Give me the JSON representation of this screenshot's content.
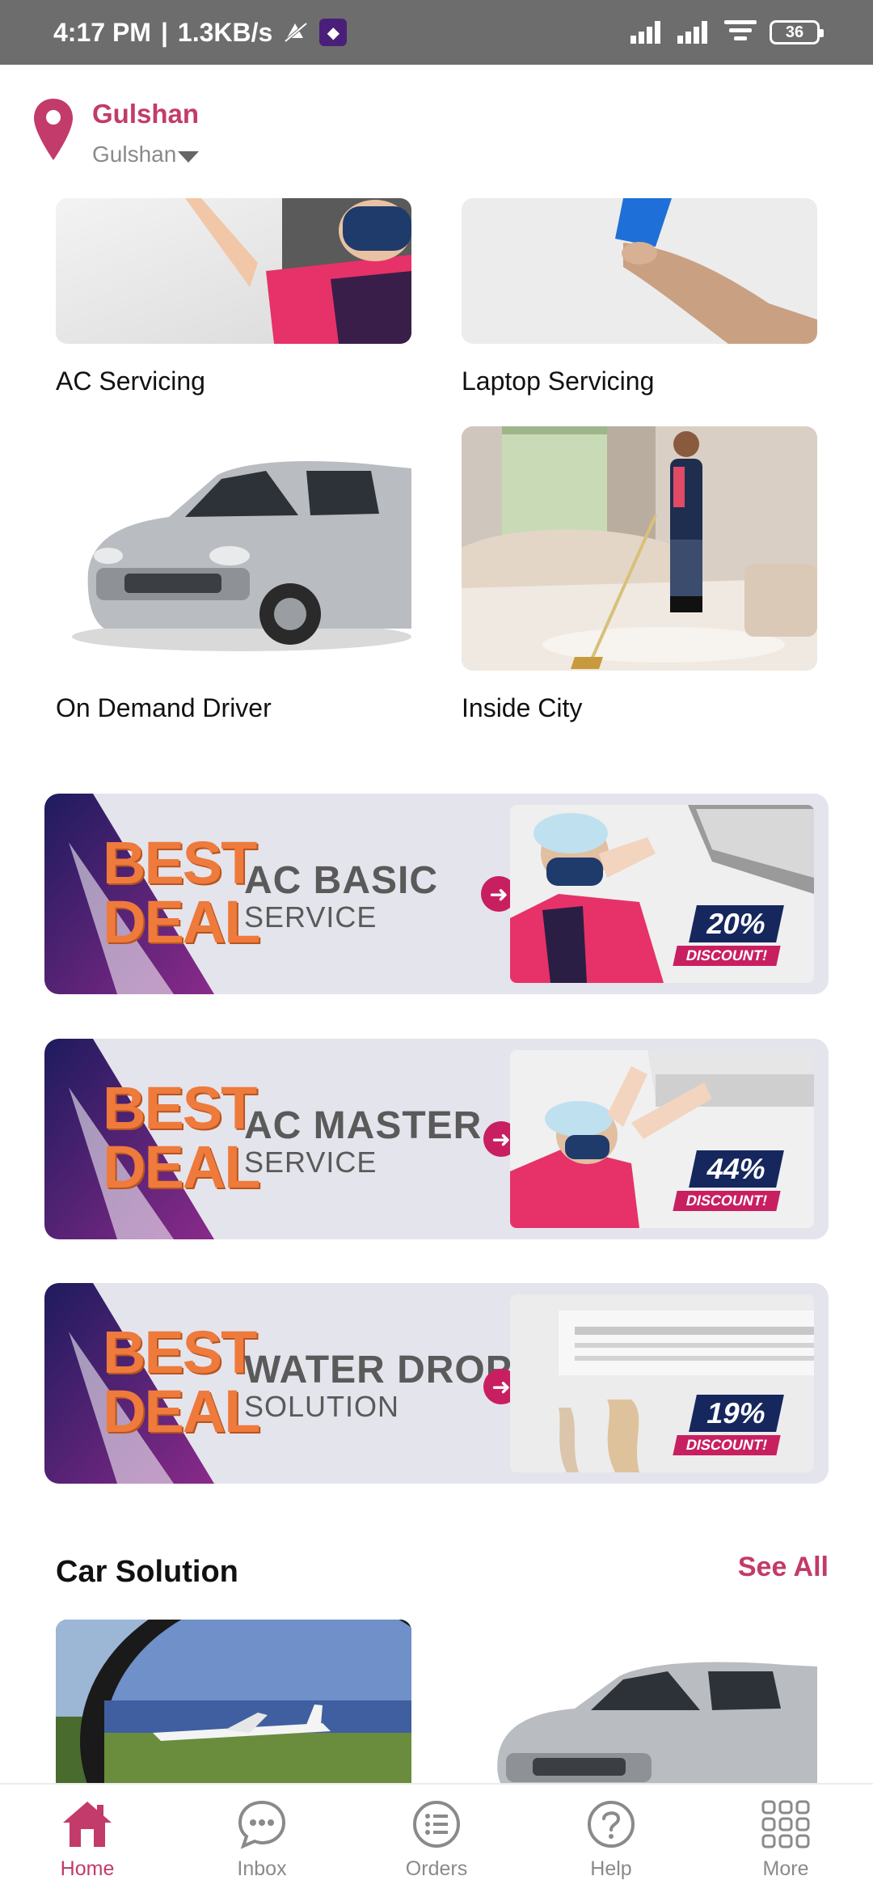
{
  "status_bar": {
    "time": "4:17 PM",
    "speed": "1.3KB/s",
    "battery": "36"
  },
  "location": {
    "title": "Gulshan",
    "subtitle": "Gulshan"
  },
  "services": [
    {
      "label": "AC Servicing"
    },
    {
      "label": "Laptop Servicing"
    },
    {
      "label": "On Demand Driver"
    },
    {
      "label": "Inside City"
    }
  ],
  "banners": [
    {
      "best": "BEST",
      "deal": "DEAL",
      "title": "AC BASIC",
      "subtitle": "SERVICE",
      "discount": "20%",
      "discount_label": "DISCOUNT!"
    },
    {
      "best": "BEST",
      "deal": "DEAL",
      "title": "AC MASTER",
      "subtitle": "SERVICE",
      "discount": "44%",
      "discount_label": "DISCOUNT!"
    },
    {
      "best": "BEST",
      "deal": "DEAL",
      "title": "WATER DROP",
      "subtitle": "SOLUTION",
      "discount": "19%",
      "discount_label": "DISCOUNT!"
    }
  ],
  "car_section": {
    "title": "Car Solution",
    "see_all": "See All"
  },
  "nav": [
    {
      "label": "Home",
      "icon": "home-icon",
      "active": true
    },
    {
      "label": "Inbox",
      "icon": "chat-icon",
      "active": false
    },
    {
      "label": "Orders",
      "icon": "list-icon",
      "active": false
    },
    {
      "label": "Help",
      "icon": "help-icon",
      "active": false
    },
    {
      "label": "More",
      "icon": "grid-icon",
      "active": false
    }
  ],
  "colors": {
    "accent": "#c23b6a",
    "banner_bg": "#e4e4ec",
    "deal_orange": "#ee7a3c",
    "navy": "#16275e"
  }
}
